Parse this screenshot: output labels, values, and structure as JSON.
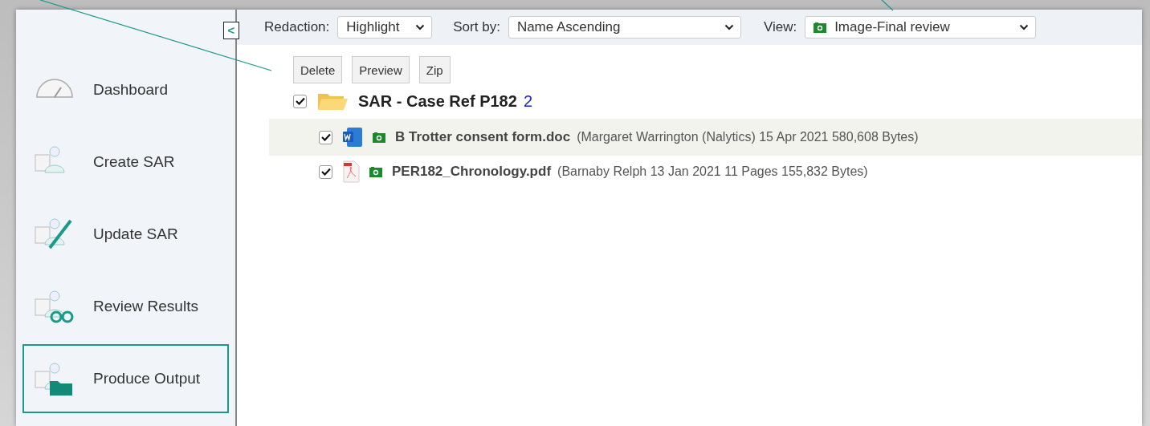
{
  "sidebar": {
    "items": [
      {
        "label": "Dashboard",
        "kind": "dashboard",
        "selected": false
      },
      {
        "label": "Create SAR",
        "kind": "create",
        "selected": false
      },
      {
        "label": "Update SAR",
        "kind": "update",
        "selected": false
      },
      {
        "label": "Review Results",
        "kind": "review",
        "selected": false
      },
      {
        "label": "Produce Output",
        "kind": "output",
        "selected": true
      }
    ]
  },
  "collapse_button": {
    "label": "<"
  },
  "toolbar": {
    "redaction": {
      "label": "Redaction:",
      "value": "Highlight"
    },
    "sort": {
      "label": "Sort by:",
      "value": "Name Ascending"
    },
    "view": {
      "label": "View:",
      "value": "Image-Final review"
    }
  },
  "actions": [
    "Delete",
    "Preview",
    "Zip"
  ],
  "folder": {
    "name": "SAR - Case Ref P182",
    "count": "2",
    "checked": true,
    "files": [
      {
        "kind": "word",
        "name": "B Trotter consent form.doc",
        "details": "(Margaret Warrington (Nalytics)  15 Apr 2021  580,608 Bytes)",
        "checked": true,
        "selected": true
      },
      {
        "kind": "pdf",
        "name": "PER182_Chronology.pdf",
        "details": "(Barnaby Relph  13 Jan 2021  11 Pages  155,832 Bytes)",
        "checked": true,
        "selected": false
      }
    ]
  }
}
